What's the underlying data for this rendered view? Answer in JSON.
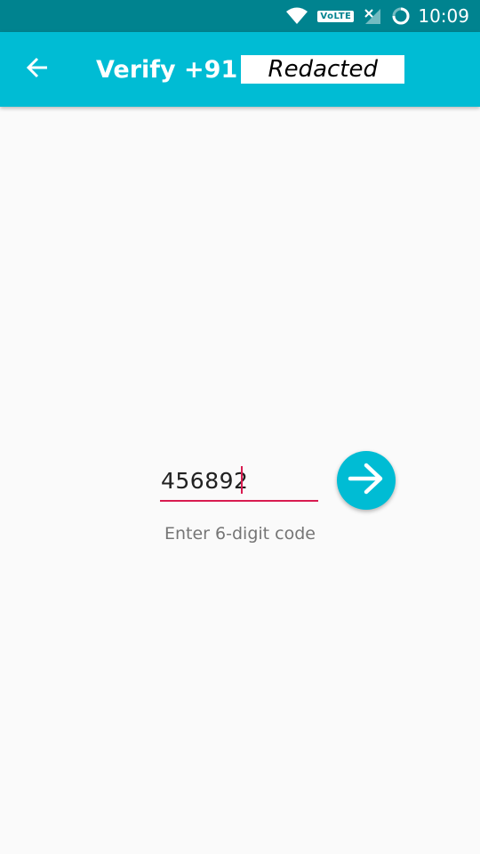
{
  "status_bar": {
    "time": "10:09",
    "network_label": "VoLTE",
    "icons": [
      "wifi-icon",
      "volte-icon",
      "signal-no-service-icon",
      "loading-ring-icon"
    ]
  },
  "app_bar": {
    "back_icon": "arrow-left-icon",
    "title_prefix": "Verify +91",
    "redacted_text": "Redacted"
  },
  "verification": {
    "code_value": "456892",
    "hint": "Enter 6-digit code",
    "submit_icon": "arrow-right-icon"
  },
  "colors": {
    "primary": "#00bcd4",
    "status_bar": "#00838f",
    "accent": "#d81b50",
    "background": "#fafafa"
  }
}
